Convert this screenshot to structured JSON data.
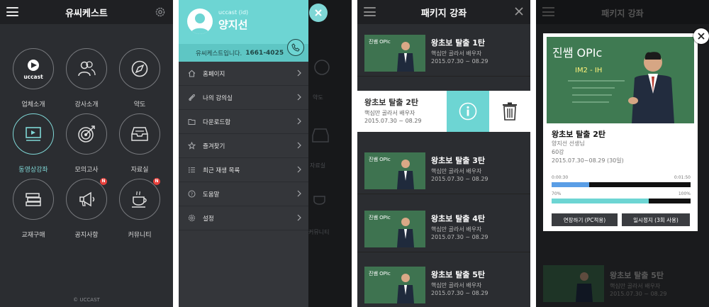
{
  "colors": {
    "accent": "#6dd5d3",
    "dark": "#2b2d31",
    "badge": "#e8423d"
  },
  "screen1": {
    "title": "유씨케스트",
    "tiles": [
      {
        "label": "업체소개",
        "icon": "uccast-logo-icon",
        "logo_text": "uccast",
        "badge": ""
      },
      {
        "label": "강사소개",
        "icon": "people-icon",
        "badge": ""
      },
      {
        "label": "약도",
        "icon": "compass-icon",
        "badge": ""
      },
      {
        "label": "동영상강좌",
        "icon": "video-play-icon",
        "badge": "",
        "active": true
      },
      {
        "label": "모의고사",
        "icon": "target-icon",
        "badge": ""
      },
      {
        "label": "자료실",
        "icon": "inbox-tray-icon",
        "badge": ""
      },
      {
        "label": "교재구매",
        "icon": "books-icon",
        "badge": ""
      },
      {
        "label": "공지사항",
        "icon": "megaphone-icon",
        "badge": "N"
      },
      {
        "label": "커뮤니티",
        "icon": "coffee-cup-icon",
        "badge": "N"
      }
    ],
    "copyright": "© UCCAST"
  },
  "screen2": {
    "user_id": "uccast (id)",
    "user_name": "양지선",
    "contact_label": "유씨케스트입니다.",
    "contact_number": "1661-4025",
    "menu": [
      {
        "label": "홈페이지",
        "icon": "home-icon"
      },
      {
        "label": "나의 강의실",
        "icon": "paperclip-icon"
      },
      {
        "label": "다운로드함",
        "icon": "folder-icon"
      },
      {
        "label": "즐겨찾기",
        "icon": "star-icon"
      },
      {
        "label": "최근 재생 목록",
        "icon": "list-icon"
      },
      {
        "label": "도움말",
        "icon": "help-icon"
      },
      {
        "label": "설정",
        "icon": "gear-icon"
      }
    ],
    "ghost_labels": [
      "약도",
      "자료실",
      "커뮤니티"
    ]
  },
  "screen3": {
    "title": "패키지 강좌",
    "thumb_text": "진쌤 OPIc",
    "rows": [
      {
        "title": "왕초보 탈출 1탄",
        "subtitle": "핵심만 골라서 배우자",
        "dates": "2015.07.30 ~ 08.29"
      },
      {
        "title": "왕초보 탈출 2탄",
        "subtitle": "핵심만 골라서 배우자",
        "dates": "2015.07.30 ~ 08.29"
      },
      {
        "title": "왕초보 탈출 3탄",
        "subtitle": "핵심만 골라서 배우자",
        "dates": "2015.07.30 ~ 08.29"
      },
      {
        "title": "왕초보 탈출 4탄",
        "subtitle": "핵심만 골라서 배우자",
        "dates": "2015.07.30 ~ 08.29"
      },
      {
        "title": "왕초보 탈출 5탄",
        "subtitle": "핵심만 골라서 배우자",
        "dates": "2015.07.30 ~ 08.29"
      }
    ]
  },
  "screen4": {
    "bg_title": "패키지 강좌",
    "thumb_title": "진쌤 OPIc",
    "thumb_sub": "IM2 - IH",
    "title": "왕초보 탈출 2탄",
    "teacher": "양지선 선생님",
    "lectures": "60강",
    "period": "2015.07.30~08.29 (30일)",
    "time_start": "0:00:30",
    "time_end": "0:01:50",
    "time_progress": 0.27,
    "pct_start": "70%",
    "pct_end": "100%",
    "pct_progress": 0.7,
    "extend_label": "연장하기",
    "extend_note": "(PC적용)",
    "pause_label": "일시정지",
    "pause_note": "(3회 사용)",
    "bg_row_title": "왕초보 탈출 5탄",
    "bg_row_sub": "핵심만 골라서 배우자",
    "bg_row_dates": "2015.07.30 ~ 08.29"
  }
}
